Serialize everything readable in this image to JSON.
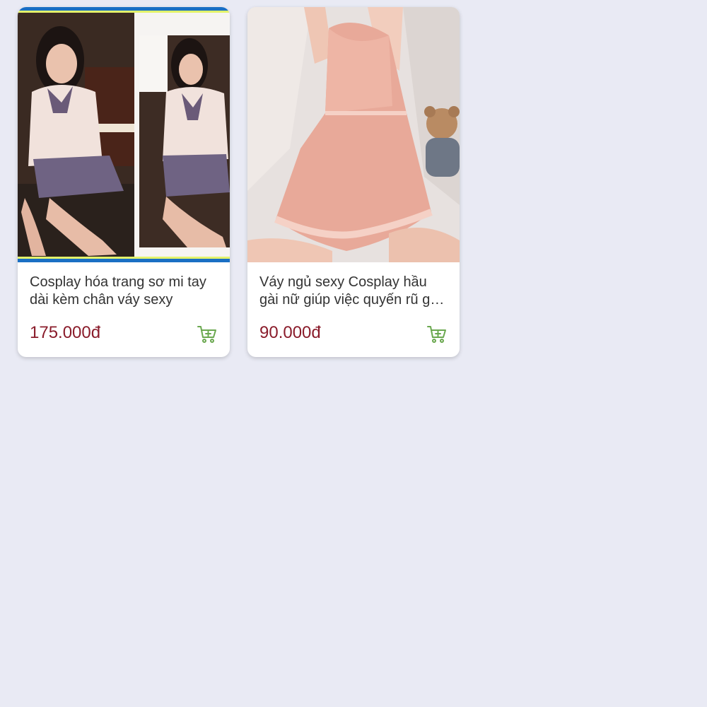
{
  "products": [
    {
      "title": "Cosplay hóa trang sơ mi tay dài kèm chân váy sexy",
      "price": "175.000đ",
      "image": "schoolgirl-uniform-photo",
      "cart_icon": "add-to-cart-icon"
    },
    {
      "title": "Váy ngủ sexy Cosplay hầu gài nữ giúp việc quyến rũ gợi cảm",
      "price": "90.000đ",
      "image": "pink-lace-nightdress-photo",
      "cart_icon": "add-to-cart-icon"
    }
  ],
  "colors": {
    "background": "#e9eaf4",
    "price": "#8a1c2b",
    "cart_icon": "#6aa84f",
    "title": "#333333"
  }
}
